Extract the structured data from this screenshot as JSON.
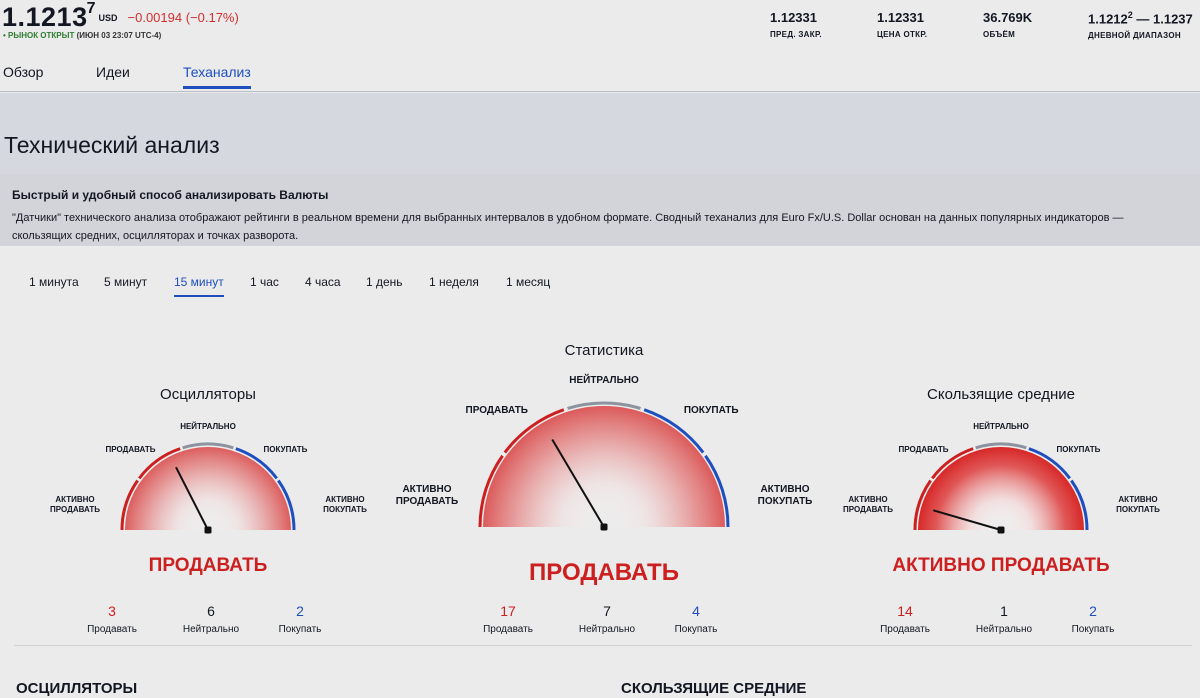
{
  "header": {
    "price_main": "1.1213",
    "price_sup": "7",
    "currency": "USD",
    "change": "−0.00194 (−0.17%)",
    "market_status": "• РЫНОК ОТКРЫТ",
    "market_time": "(ИЮН 03 23:07 UTC-4)",
    "stats": [
      {
        "value": "1.12331",
        "label": "ПРЕД. ЗАКР."
      },
      {
        "value": "1.12331",
        "label": "ЦЕНА ОТКР."
      },
      {
        "value": "36.769K",
        "label": "ОБЪЁМ"
      },
      {
        "value_a": "1.1212",
        "value_a_sup": "2",
        "value_b": " — 1.1237",
        "label": "ДНЕВНОЙ ДИАПАЗОН"
      }
    ]
  },
  "tabs": [
    {
      "label": "Обзор",
      "active": false
    },
    {
      "label": "Идеи",
      "active": false
    },
    {
      "label": "Теханализ",
      "active": true
    }
  ],
  "page_title": "Технический анализ",
  "info": {
    "title": "Быстрый и удобный способ анализировать Валюты",
    "text": "\"Датчики\" технического анализа отображают рейтинги в реальном времени для выбранных интервалов в удобном формате. Сводный теханализ для Euro Fx/U.S. Dollar основан на данных популярных индикаторов — скользящих средних, осцилляторах и точках разворота."
  },
  "intervals": [
    {
      "label": "1 минута",
      "active": false
    },
    {
      "label": "5 минут",
      "active": false
    },
    {
      "label": "15 минут",
      "active": true
    },
    {
      "label": "1 час",
      "active": false
    },
    {
      "label": "4 часа",
      "active": false
    },
    {
      "label": "1 день",
      "active": false
    },
    {
      "label": "1 неделя",
      "active": false
    },
    {
      "label": "1 месяц",
      "active": false
    }
  ],
  "gauge_labels": {
    "strong_sell": "АКТИВНО\nПРОДАВАТЬ",
    "sell": "ПРОДАВАТЬ",
    "neutral": "НЕЙТРАЛЬНО",
    "buy": "ПОКУПАТЬ",
    "strong_buy": "АКТИВНО\nПОКУПАТЬ"
  },
  "count_labels": {
    "sell": "Продавать",
    "neutral": "Нейтрально",
    "buy": "Покупать"
  },
  "gauges": [
    {
      "id": "oscillators",
      "title": "Осцилляторы",
      "verdict": "ПРОДАВАТЬ",
      "needle": 0.35,
      "sell": "3",
      "neutral": "6",
      "buy": "2",
      "intensity": "light"
    },
    {
      "id": "summary",
      "title": "Статистика",
      "verdict": "ПРОДАВАТЬ",
      "needle": 0.33,
      "sell": "17",
      "neutral": "7",
      "buy": "4",
      "intensity": "light"
    },
    {
      "id": "moving_averages",
      "title": "Скользящие средние",
      "verdict": "АКТИВНО ПРОДАВАТЬ",
      "needle": 0.09,
      "sell": "14",
      "neutral": "1",
      "buy": "2",
      "intensity": "strong"
    }
  ],
  "sections": {
    "oscillators": "ОСЦИЛЛЯТОРЫ",
    "moving_averages": "СКОЛЬЗЯЩИЕ СРЕДНИЕ"
  },
  "colors": {
    "sell": "#cc1f1f",
    "neutral": "#8c929e",
    "buy": "#1e4fbf",
    "accent": "#1e4fbf"
  }
}
